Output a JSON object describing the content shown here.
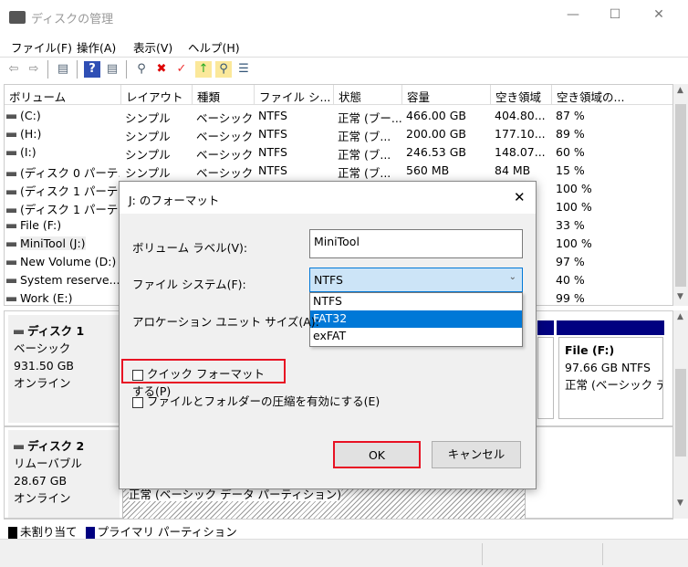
{
  "window": {
    "title": "ディスクの管理",
    "minimize": "—",
    "maximize": "☐",
    "close": "✕"
  },
  "menu": [
    "ファイル(F)",
    "操作(A)",
    "表示(V)",
    "ヘルプ(H)"
  ],
  "toolbar": [
    "back-icon",
    "forward-icon",
    "console-tree-icon",
    "help-icon",
    "action-pane-icon",
    "connect-drive-icon",
    "delete-icon",
    "properties-icon",
    "folder-up-icon",
    "search-folder-icon",
    "settings-list-icon"
  ],
  "table": {
    "headers": [
      "ボリューム",
      "レイアウト",
      "種類",
      "ファイル シ...",
      "状態",
      "容量",
      "空き領域",
      "空き領域の..."
    ],
    "rows": [
      [
        "(C:)",
        "シンプル",
        "ベーシック",
        "NTFS",
        "正常 (ブー...",
        "466.00 GB",
        "404.80...",
        "87 %"
      ],
      [
        "(H:)",
        "シンプル",
        "ベーシック",
        "NTFS",
        "正常 (ブ...",
        "200.00 GB",
        "177.10...",
        "89 %"
      ],
      [
        "(I:)",
        "シンプル",
        "ベーシック",
        "NTFS",
        "正常 (ブ...",
        "246.53 GB",
        "148.07...",
        "60 %"
      ],
      [
        "(ディスク 0 パーテ...",
        "シンプル",
        "ベーシック",
        "NTFS",
        "正常 (ブ...",
        "560 MB",
        "84 MB",
        "15 %"
      ],
      [
        "(ディスク 1 パーテ...",
        "",
        "",
        "",
        "",
        "",
        "",
        "100 %"
      ],
      [
        "(ディスク 1 パーテ...",
        "",
        "",
        "",
        "",
        "",
        "",
        "100 %"
      ],
      [
        "File (F:)",
        "",
        "",
        "",
        "",
        "",
        "",
        "33 %"
      ],
      [
        "MiniTool (J:)",
        "",
        "",
        "",
        "",
        "",
        "",
        "100 %"
      ],
      [
        "New Volume (D:)",
        "",
        "",
        "",
        "",
        "",
        "",
        "97 %"
      ],
      [
        "System reserve...",
        "",
        "",
        "",
        "",
        "",
        "",
        "40 %"
      ],
      [
        "Work (E:)",
        "",
        "",
        "",
        "",
        "",
        "",
        "99 %"
      ]
    ]
  },
  "disks": [
    {
      "name": "ディスク 1",
      "type": "ベーシック",
      "size": "931.50 GB",
      "status": "オンライン"
    },
    {
      "name": "ディスク 2",
      "type": "リムーバブル",
      "size": "28.67 GB",
      "status": "オンライン"
    }
  ],
  "partitions": {
    "file_f": {
      "name": "File  (F:)",
      "size": "97.66 GB NTFS",
      "status": "正常 (ベーシック デ"
    },
    "disk2_part": {
      "status": "正常 (ベーシック データ パーティション)"
    }
  },
  "legend": {
    "unallocated": "未割り当て",
    "primary": "プライマリ パーティション",
    "unallocated_color": "#000000",
    "primary_color": "#000080"
  },
  "dialog": {
    "title": "J: のフォーマット",
    "close": "✕",
    "volume_label": "ボリューム ラベル(V):",
    "volume_value": "MiniTool",
    "fs_label": "ファイル システム(F):",
    "fs_value": "NTFS",
    "fs_options": [
      "NTFS",
      "FAT32",
      "exFAT"
    ],
    "fs_highlighted": "FAT32",
    "alloc_label": "アロケーション ユニット サイズ(A):",
    "quick_format": "クイック フォーマットする(P)",
    "quick_format_checked": false,
    "compression": "ファイルとフォルダーの圧縮を有効にする(E)",
    "compression_checked": false,
    "ok": "OK",
    "cancel": "キャンセル",
    "highlight_color": "#e81123",
    "accent": "#0078d7"
  }
}
